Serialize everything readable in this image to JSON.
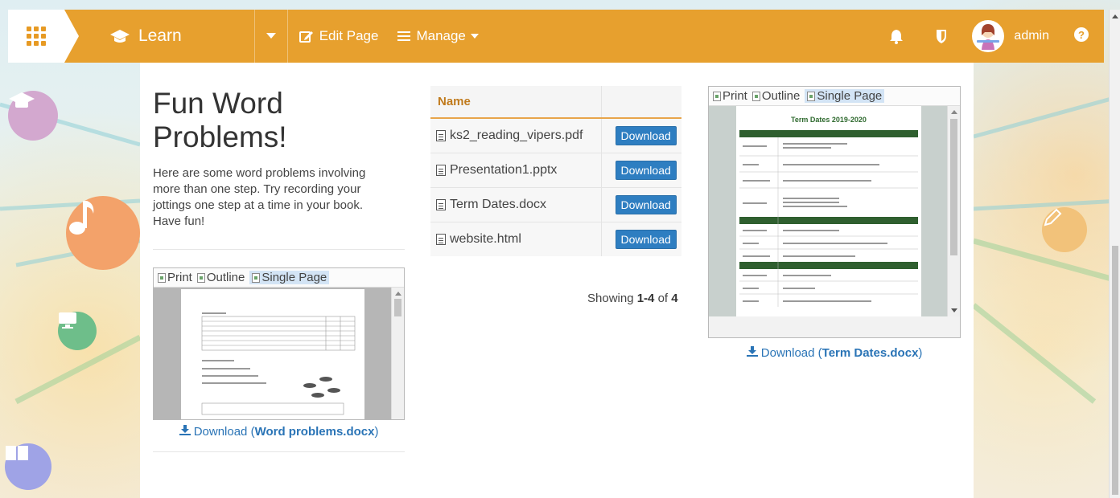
{
  "nav": {
    "brand_label": "Learn",
    "edit_label": "Edit Page",
    "manage_label": "Manage",
    "user_name": "admin",
    "accent_color": "#e7a02e"
  },
  "page": {
    "title_line1": "Fun Word",
    "title_line2": "Problems!",
    "description": "Here are some word problems involving more than one step. Try recording your jottings one step at a time in your book. Have fun!"
  },
  "viewer_left": {
    "tabs": [
      "Print",
      "Outline",
      "Single Page"
    ],
    "download_prefix": "Download (",
    "download_file": "Word problems.docx",
    "download_suffix": ")"
  },
  "files": {
    "header_name": "Name",
    "rows": [
      {
        "name": "ks2_reading_vipers.pdf",
        "action": "Download"
      },
      {
        "name": "Presentation1.pptx",
        "action": "Download"
      },
      {
        "name": "Term Dates.docx",
        "action": "Download"
      },
      {
        "name": "website.html",
        "action": "Download"
      }
    ],
    "showing_prefix": "Showing ",
    "showing_range": "1-4",
    "showing_mid": " of ",
    "showing_total": "4"
  },
  "viewer_right": {
    "tabs": [
      "Print",
      "Outline",
      "Single Page"
    ],
    "doc_title": "Term Dates 2019-2020",
    "download_prefix": "Download (",
    "download_file": "Term Dates.docx",
    "download_suffix": ")"
  }
}
